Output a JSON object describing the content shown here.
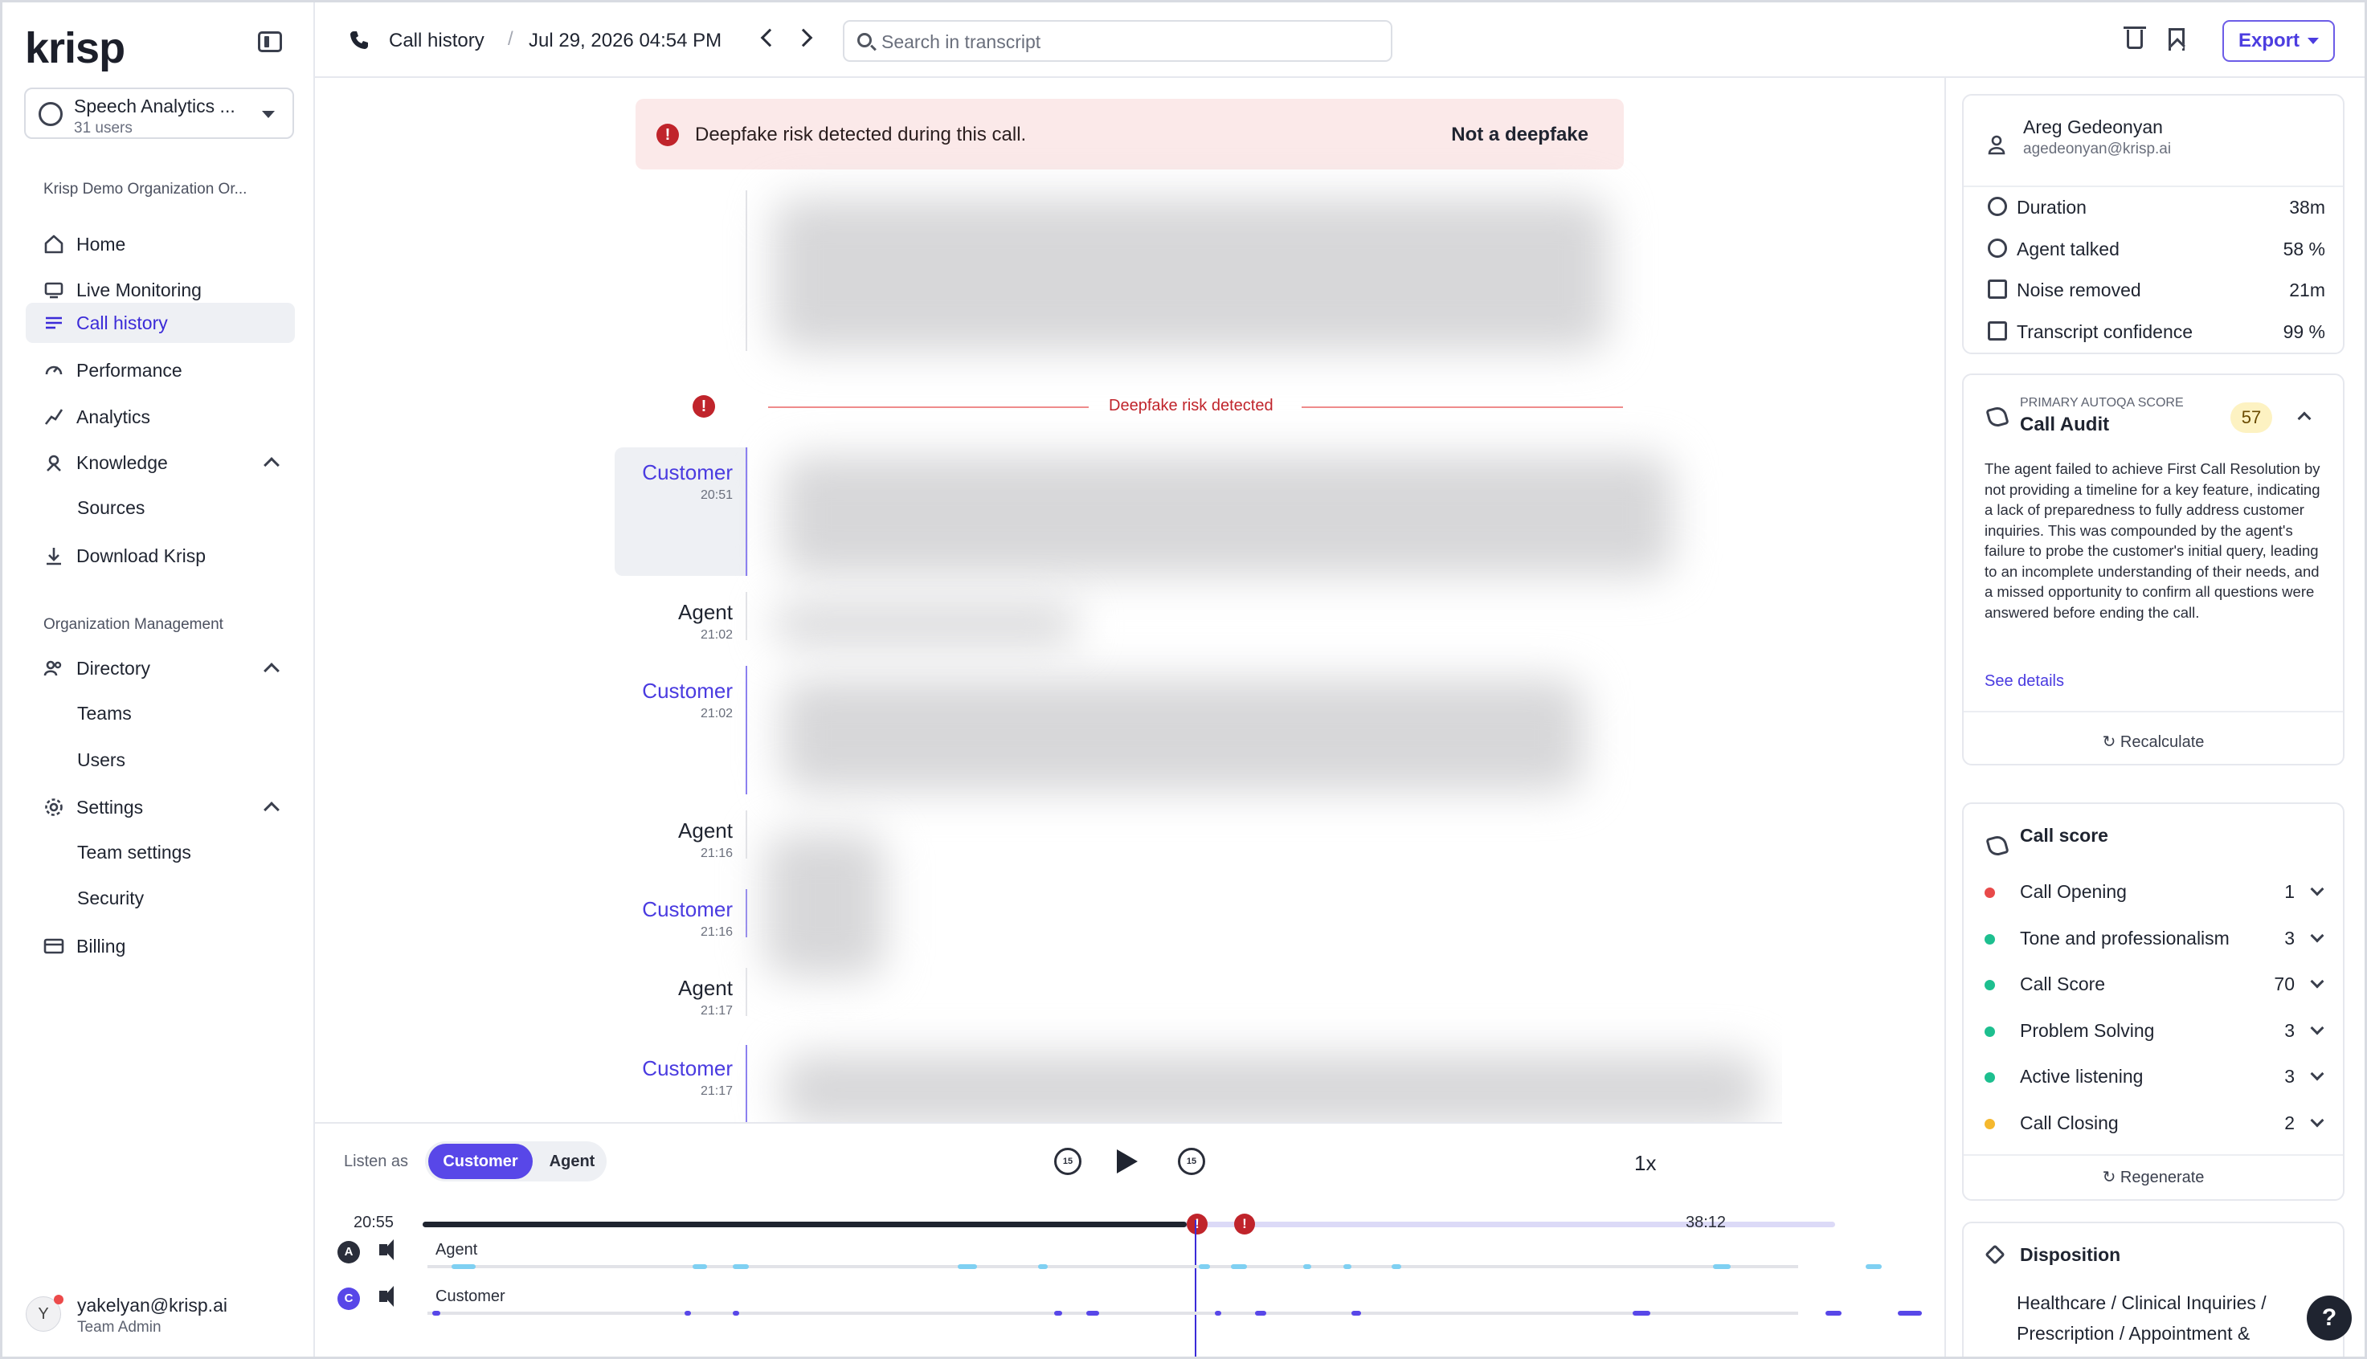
{
  "sidebar": {
    "logo": "krisp",
    "team": {
      "name": "Speech Analytics ...",
      "sub": "31 users"
    },
    "org_label": "Krisp Demo Organization Or...",
    "items": [
      {
        "label": "Home"
      },
      {
        "label": "Live Monitoring"
      },
      {
        "label": "Call history"
      },
      {
        "label": "Performance"
      },
      {
        "label": "Analytics"
      },
      {
        "label": "Knowledge"
      },
      {
        "label": "Sources"
      },
      {
        "label": "Download Krisp"
      }
    ],
    "mgmt_label": "Organization Management",
    "mgmt": [
      {
        "label": "Directory"
      },
      {
        "label": "Teams"
      },
      {
        "label": "Users"
      },
      {
        "label": "Settings"
      },
      {
        "label": "Team settings"
      },
      {
        "label": "Security"
      },
      {
        "label": "Billing"
      }
    ],
    "user": {
      "initial": "Y",
      "email": "yakelyan@krisp.ai",
      "role": "Team Admin"
    }
  },
  "topbar": {
    "crumb": "Call history",
    "sep": "/",
    "date": "Jul 29, 2026 04:54 PM",
    "search_placeholder": "Search in transcript",
    "export_label": "Export"
  },
  "alert": {
    "message": "Deepfake risk detected during this call.",
    "action": "Not a deepfake"
  },
  "marker": {
    "label": "Deepfake risk detected"
  },
  "transcript": [
    {
      "speaker": "Customer",
      "time": "20:51"
    },
    {
      "speaker": "Agent",
      "time": "21:02"
    },
    {
      "speaker": "Customer",
      "time": "21:02"
    },
    {
      "speaker": "Agent",
      "time": "21:16"
    },
    {
      "speaker": "Customer",
      "time": "21:16"
    },
    {
      "speaker": "Agent",
      "time": "21:17"
    },
    {
      "speaker": "Customer",
      "time": "21:17"
    }
  ],
  "player": {
    "listen_label": "Listen as",
    "opt_customer": "Customer",
    "opt_agent": "Agent",
    "skip_back": "15",
    "skip_fwd": "15",
    "speed": "1x",
    "current_time": "20:55",
    "total_time": "38:12",
    "progress": 0.541,
    "channels": [
      {
        "badge": "A",
        "name": "Agent",
        "color": "#7fd0f2"
      },
      {
        "badge": "C",
        "name": "Customer",
        "color": "#5847e8"
      }
    ]
  },
  "right": {
    "person": {
      "name": "Areg Gedeonyan",
      "email": "agedeonyan@krisp.ai"
    },
    "stats": [
      {
        "label": "Duration",
        "value": "38m"
      },
      {
        "label": "Agent talked",
        "value": "58 %"
      },
      {
        "label": "Noise removed",
        "value": "21m"
      },
      {
        "label": "Transcript confidence",
        "value": "99 %"
      }
    ],
    "audit": {
      "kicker": "PRIMARY AUTOQA SCORE",
      "title": "Call Audit",
      "score": "57",
      "text": "The agent failed to achieve First Call Resolution by not providing a timeline for a key feature, indicating a lack of preparedness to fully address customer inquiries. This was compounded by the agent's failure to probe the customer's initial query, leading to an incomplete understanding of their needs, and a missed opportunity to confirm all questions were answered before ending the call.",
      "see_details": "See details",
      "recalculate": "Recalculate"
    },
    "call_score": {
      "title": "Call score",
      "rows": [
        {
          "label": "Call Opening",
          "value": "1",
          "color": "#e84a4a"
        },
        {
          "label": "Tone and professionalism",
          "value": "3",
          "color": "#1dbf8f"
        },
        {
          "label": "Call Score",
          "value": "70",
          "color": "#1dbf8f"
        },
        {
          "label": "Problem Solving",
          "value": "3",
          "color": "#1dbf8f"
        },
        {
          "label": "Active listening",
          "value": "3",
          "color": "#1dbf8f"
        },
        {
          "label": "Call Closing",
          "value": "2",
          "color": "#f5b82e"
        }
      ],
      "regenerate": "Regenerate"
    },
    "disposition": {
      "title": "Disposition",
      "text": "Healthcare / Clinical Inquiries / Prescription / Appointment &"
    }
  },
  "help": "?"
}
